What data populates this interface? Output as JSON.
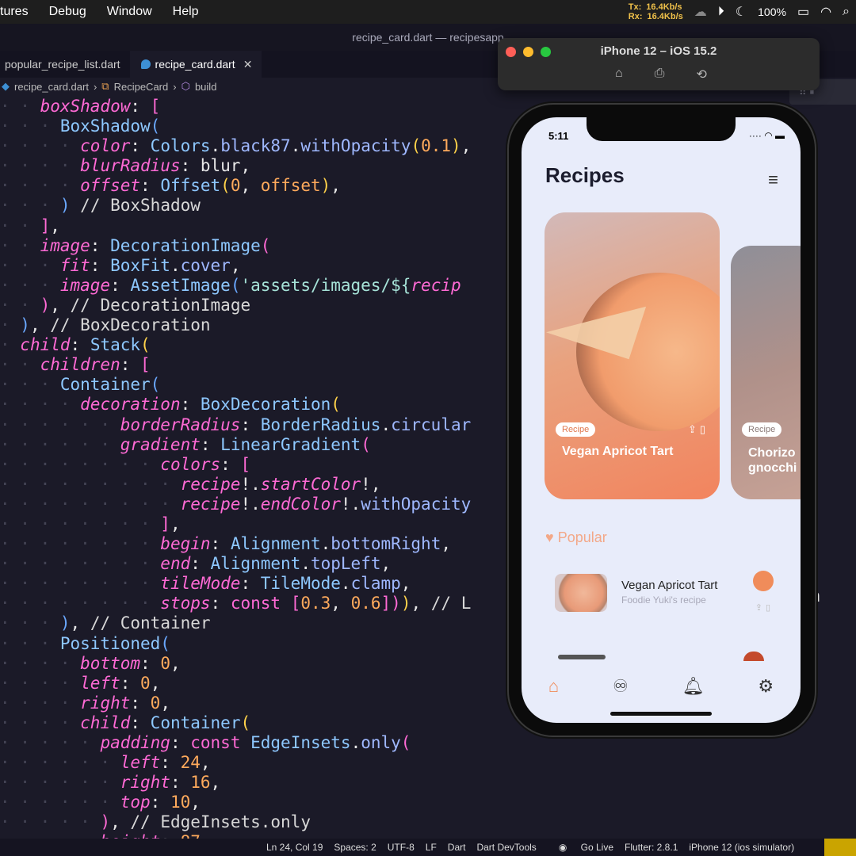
{
  "menubar": {
    "items": [
      "tures",
      "Debug",
      "Window",
      "Help"
    ],
    "net_tx_label": "Tx:",
    "net_tx": "16.4Kb/s",
    "net_rx_label": "Rx:",
    "net_rx": "16.4Kb/s",
    "battery": "100%"
  },
  "window_title": "recipe_card.dart — recipesapp",
  "tabs": [
    {
      "label": "popular_recipe_list.dart"
    },
    {
      "label": "recipe_card.dart"
    }
  ],
  "breadcrumb": [
    "recipe_card.dart",
    "RecipeCard",
    "build"
  ],
  "code_tail_fragment": "on",
  "status": {
    "pos": "Ln 24, Col 19",
    "spaces": "Spaces: 2",
    "enc": "UTF-8",
    "eol": "LF",
    "lang": "Dart",
    "devtools": "Dart DevTools",
    "golive": "Go Live",
    "flutter": "Flutter: 2.8.1",
    "device": "iPhone 12 (ios simulator)"
  },
  "simulator": {
    "title": "iPhone 12 – iOS 15.2",
    "icons": [
      "home-icon",
      "screenshot-icon",
      "rotate-icon"
    ]
  },
  "phone": {
    "time": "5:11",
    "app_title": "Recipes",
    "cards": [
      {
        "tag": "Recipe",
        "title": "Vegan Apricot Tart"
      },
      {
        "tag": "Recipe",
        "title_line1": "Chorizo",
        "title_line2": "gnocchi"
      }
    ],
    "popular_label": "Popular",
    "popular_items": [
      {
        "title": "Vegan Apricot Tart",
        "subtitle": "Foodie Yuki's recipe"
      }
    ],
    "nav": [
      "home-icon",
      "glasses-icon",
      "bell-icon",
      "gear-icon"
    ]
  },
  "colors": {
    "accent": "#f08c5a",
    "editor_bg": "#1b1a28",
    "param": "#ff6ad5",
    "number": "#ffaa5c"
  }
}
